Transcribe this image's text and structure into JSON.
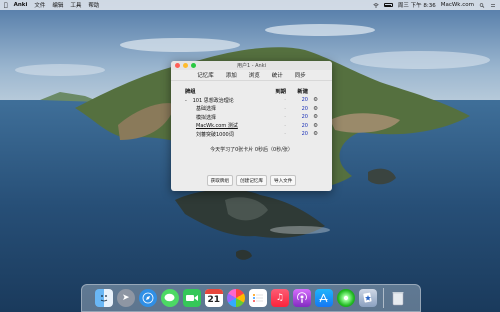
{
  "menubar": {
    "app_name": "Anki",
    "items": [
      "文件",
      "编辑",
      "工具",
      "帮助"
    ],
    "clock": "周三 下午 8:36",
    "site": "MacWk.com"
  },
  "window": {
    "title": "用户1 - Anki",
    "toolbar": [
      "记忆库",
      "添加",
      "浏览",
      "统计",
      "同步"
    ],
    "columns": {
      "deck": "牌组",
      "due": "到期",
      "new": "新建"
    },
    "decks": [
      {
        "expander": "-",
        "name": "101 思想政治理论",
        "due": "-",
        "new": "20"
      },
      {
        "expander": "",
        "name": "基础选择",
        "due": "-",
        "new": "20"
      },
      {
        "expander": "",
        "name": "模拟选择",
        "due": "-",
        "new": "20"
      },
      {
        "expander": "",
        "name": "MacWk.com 测试",
        "due": "-",
        "new": "20"
      },
      {
        "expander": "",
        "name": "刘蕃突破1000词",
        "due": "-",
        "new": "20"
      }
    ],
    "study_summary": "今天学习了0张卡片 0秒后（0秒/张）",
    "buttons": [
      "获取牌组",
      "创建记忆库",
      "导入文件"
    ]
  },
  "dock": {
    "calendar_day": "21",
    "icons": [
      "finder-icon",
      "launchpad-icon",
      "safari-icon",
      "messages-icon",
      "facetime-icon",
      "calendar-icon",
      "photos-icon",
      "reminders-icon",
      "music-icon",
      "podcasts-icon",
      "app-store-icon",
      "green-app-icon",
      "anki-icon",
      "trash-icon"
    ]
  }
}
